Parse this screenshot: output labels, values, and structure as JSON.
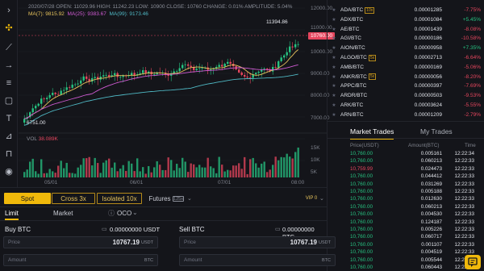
{
  "chart": {
    "info1": "2020/07/28 OPEN: 11029.96 HIGH: 11242.23 LOW: 10900 CLOSE: 10760 CHANGE: 0.01% AMPLITUDE: 5.04%",
    "ma7_label": "MA(7): 9815.92",
    "ma25_label": "MA(25): 9383.67",
    "ma99_label": "MA(99): 9173.46",
    "high_tag": "11394.86",
    "low_tag": "6751.00",
    "current_price": "10760.00",
    "y_labels": [
      "12000.00",
      "11000.00",
      "10000.00",
      "9000.00",
      "8000.00",
      "7000.00"
    ],
    "vol_label": "VOL",
    "vol_value": "38.089K",
    "vol_y_labels": [
      "15K",
      "10K",
      "5K"
    ],
    "x_labels": [
      "05/01",
      "06/01",
      "07/01",
      "08:00"
    ]
  },
  "pairs": [
    {
      "name": "ADA/BTC",
      "lev": "10x",
      "price": "0.00001285",
      "change": "-7.75%",
      "dir": "down"
    },
    {
      "name": "ADX/BTC",
      "lev": "",
      "price": "0.00001084",
      "change": "+5.45%",
      "dir": "up"
    },
    {
      "name": "AE/BTC",
      "lev": "",
      "price": "0.00001439",
      "change": "-8.08%",
      "dir": "down"
    },
    {
      "name": "AGI/BTC",
      "lev": "",
      "price": "0.00000186",
      "change": "-10.58%",
      "dir": "down"
    },
    {
      "name": "AION/BTC",
      "lev": "",
      "price": "0.00000958",
      "change": "+7.35%",
      "dir": "up"
    },
    {
      "name": "ALGO/BTC",
      "lev": "5x",
      "price": "0.00002713",
      "change": "-6.64%",
      "dir": "down"
    },
    {
      "name": "AMB/BTC",
      "lev": "",
      "price": "0.00000169",
      "change": "-5.06%",
      "dir": "down"
    },
    {
      "name": "ANKR/BTC",
      "lev": "5x",
      "price": "0.00000056",
      "change": "-8.20%",
      "dir": "down"
    },
    {
      "name": "APPC/BTC",
      "lev": "",
      "price": "0.00000397",
      "change": "-7.69%",
      "dir": "down"
    },
    {
      "name": "ARDR/BTC",
      "lev": "",
      "price": "0.00000503",
      "change": "-9.53%",
      "dir": "down"
    },
    {
      "name": "ARK/BTC",
      "lev": "",
      "price": "0.00003624",
      "change": "-5.55%",
      "dir": "down"
    },
    {
      "name": "ARN/BTC",
      "lev": "",
      "price": "0.00001209",
      "change": "-2.79%",
      "dir": "down"
    }
  ],
  "trades_panel": {
    "tab_market": "Market Trades",
    "tab_my": "My Trades",
    "col_price": "Price(USDT)",
    "col_amount": "Amount(BTC)",
    "col_time": "Time",
    "rows": [
      {
        "price": "10,760.00",
        "amount": "0.005161",
        "time": "12:22:34",
        "dir": "up"
      },
      {
        "price": "10,760.00",
        "amount": "0.060213",
        "time": "12:22:33",
        "dir": "up"
      },
      {
        "price": "10,759.99",
        "amount": "0.024473",
        "time": "12:22:33",
        "dir": "down"
      },
      {
        "price": "10,760.00",
        "amount": "0.044412",
        "time": "12:22:33",
        "dir": "up"
      },
      {
        "price": "10,760.00",
        "amount": "0.031269",
        "time": "12:22:33",
        "dir": "up"
      },
      {
        "price": "10,760.00",
        "amount": "0.005188",
        "time": "12:22:33",
        "dir": "up"
      },
      {
        "price": "10,760.00",
        "amount": "0.012630",
        "time": "12:22:33",
        "dir": "up"
      },
      {
        "price": "10,760.00",
        "amount": "0.060213",
        "time": "12:22:33",
        "dir": "up"
      },
      {
        "price": "10,760.00",
        "amount": "0.004530",
        "time": "12:22:33",
        "dir": "up"
      },
      {
        "price": "10,760.00",
        "amount": "0.124187",
        "time": "12:22:33",
        "dir": "up"
      },
      {
        "price": "10,760.00",
        "amount": "0.005226",
        "time": "12:22:33",
        "dir": "up"
      },
      {
        "price": "10,760.00",
        "amount": "0.060717",
        "time": "12:22:33",
        "dir": "up"
      },
      {
        "price": "10,760.00",
        "amount": "0.001107",
        "time": "12:22:33",
        "dir": "up"
      },
      {
        "price": "10,760.00",
        "amount": "0.004519",
        "time": "12:22:33",
        "dir": "up"
      },
      {
        "price": "10,760.00",
        "amount": "0.005544",
        "time": "12:22:33",
        "dir": "up"
      },
      {
        "price": "10,760.00",
        "amount": "0.060443",
        "time": "12:22:33",
        "dir": "up"
      }
    ]
  },
  "order_form": {
    "spot": "Spot",
    "cross": "Cross 3x",
    "isolated": "Isolated 10x",
    "futures": "Futures",
    "futures_badge": "125x",
    "vip": "VIP 0",
    "tab_limit": "Limit",
    "tab_market": "Market",
    "tab_oco": "OCO",
    "buy_title": "Buy BTC",
    "buy_balance": "0.00000000 USDT",
    "sell_title": "Sell BTC",
    "sell_balance": "0.00000000 BTC",
    "price_label": "Price",
    "price_value": "10767.19",
    "price_unit": "USDT",
    "amount_label": "Amount",
    "amount_unit": "BTC"
  },
  "colors": {
    "up": "#26c281",
    "down": "#e6465e",
    "accent": "#f0b90b"
  }
}
